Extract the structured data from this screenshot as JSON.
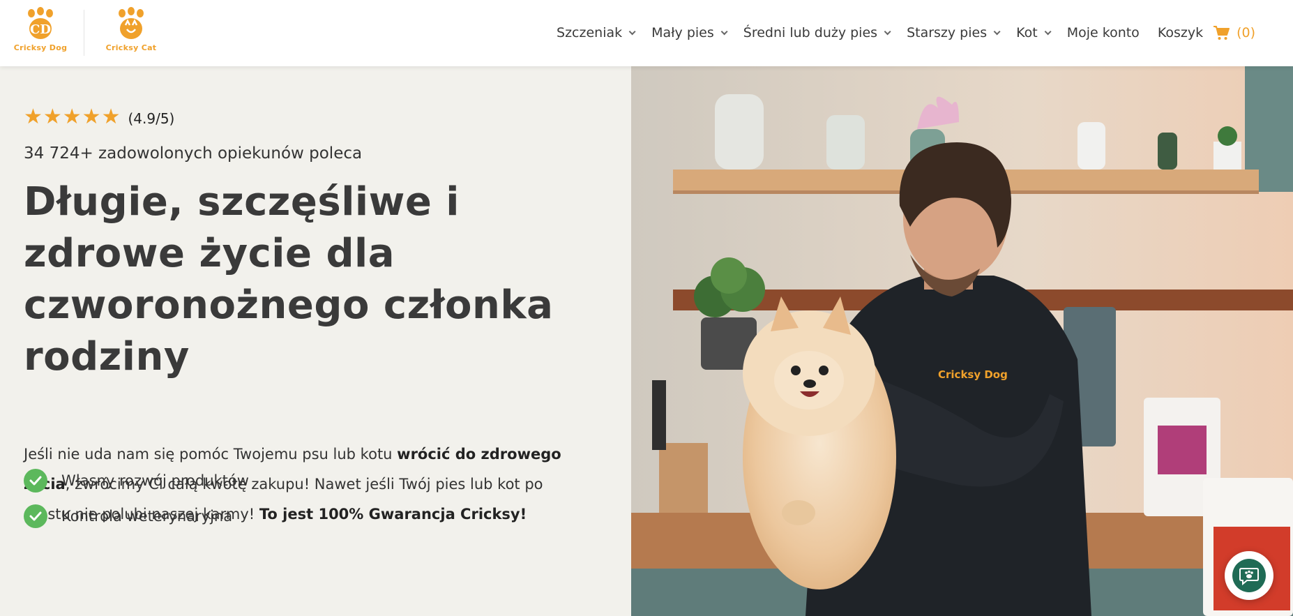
{
  "header": {
    "logos": [
      {
        "text": "Cricksy Dog",
        "icon": "paw-dog-icon"
      },
      {
        "text": "Cricksy Cat",
        "icon": "paw-cat-icon"
      }
    ],
    "nav": [
      {
        "label": "Szczeniak",
        "dropdown": true
      },
      {
        "label": "Mały pies",
        "dropdown": true
      },
      {
        "label": "Średni lub duży pies",
        "dropdown": true
      },
      {
        "label": "Starszy pies",
        "dropdown": true
      },
      {
        "label": "Kot",
        "dropdown": true
      },
      {
        "label": "Moje konto",
        "dropdown": false
      },
      {
        "label": "Koszyk",
        "dropdown": false
      }
    ],
    "cart_count": "(0)"
  },
  "hero": {
    "stars": "★★★★★",
    "rating": "(4.9/5)",
    "recommend": "34 724+ zadowolonych opiekunów poleca",
    "headline": "Długie, szczęśliwe i zdrowe życie dla czworonożnego członka rodziny",
    "paragraph": {
      "p1": "Jeśli nie uda nam się pomóc Twojemu psu lub kotu ",
      "b1": "wrócić do zdrowego życia",
      "p2": ", zwrócimy Ci całą kwotę zakupu! Nawet jeśli Twój pies lub kot po prostu nie polubi naszej karmy! ",
      "b2": "To jest 100% Gwarancja Cricksy!"
    },
    "features": [
      "Własny rozwój produktów",
      "Kontrola weterynaryjna"
    ]
  },
  "colors": {
    "accent": "#f0a12b",
    "check": "#5cb85c",
    "background": "#f2f1ec",
    "chat": "#1f6b55"
  }
}
